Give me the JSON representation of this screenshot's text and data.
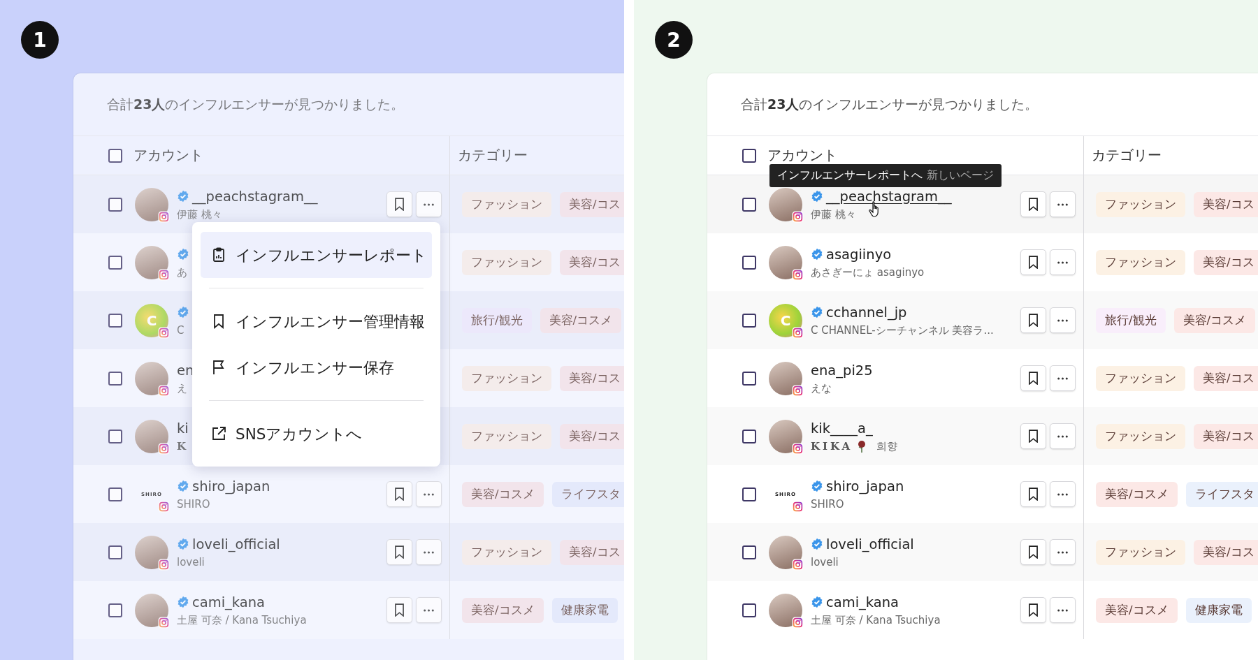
{
  "panels": [
    {
      "number": "1",
      "color": "#c9d1fb",
      "dimmed": true,
      "summary": "合計**23人**のインフルエンサーが見つかりました。",
      "header_checked": false,
      "columns": [
        "アカウント",
        "カテゴリー"
      ],
      "rows": [
        {
          "name": "__peachstagram__",
          "verified": true,
          "sub": "伊藤 桃々",
          "avatar": {
            "kind": "photo"
          },
          "checked": false,
          "hovered": false,
          "actions": true,
          "tags": [
            {
              "label": "ファッション",
              "color": "#f6ebe6"
            },
            {
              "label": "美容/コス",
              "color": "#f4e1e6"
            }
          ]
        },
        {
          "verified": true,
          "sub": "あ",
          "avatar": {
            "kind": "photo"
          },
          "checked": false,
          "hovered": false,
          "actions": false,
          "tags": [
            {
              "label": "ファッション",
              "color": "#f6ebe6"
            },
            {
              "label": "美容/コス",
              "color": "#f4e1e6"
            }
          ]
        },
        {
          "verified": true,
          "sub": "C",
          "avatar": {
            "kind": "logo",
            "text": "C"
          },
          "checked": false,
          "hovered": false,
          "actions": false,
          "tags": [
            {
              "label": "旅行/観光",
              "color": "#ece6fb"
            },
            {
              "label": "美容/コスメ",
              "color": "#f4e1e6"
            }
          ]
        },
        {
          "name": "en",
          "verified": false,
          "sub": "え",
          "avatar": {
            "kind": "photo"
          },
          "checked": false,
          "hovered": false,
          "actions": false,
          "tags": [
            {
              "label": "ファッション",
              "color": "#f6ebe6"
            },
            {
              "label": "美容/コス",
              "color": "#f4e1e6"
            }
          ]
        },
        {
          "name": "ki",
          "verified": false,
          "sub": "K",
          "kind": "serif",
          "avatar": {
            "kind": "photo"
          },
          "checked": false,
          "hovered": false,
          "actions": false,
          "tags": [
            {
              "label": "ファッション",
              "color": "#f6ebe6"
            },
            {
              "label": "美容/コス",
              "color": "#f4e1e6"
            }
          ]
        },
        {
          "name": "shiro_japan",
          "verified": true,
          "sub": "SHIRO",
          "avatar": {
            "kind": "wordmark",
            "text": "SHIRO"
          },
          "checked": false,
          "hovered": false,
          "actions": true,
          "tags": [
            {
              "label": "美容/コスメ",
              "color": "#f4e1e6"
            },
            {
              "label": "ライフスタ",
              "color": "#e2e8fb"
            }
          ]
        },
        {
          "name": "loveli_official",
          "verified": true,
          "sub": "loveli",
          "avatar": {
            "kind": "photo"
          },
          "checked": false,
          "hovered": false,
          "actions": true,
          "tags": [
            {
              "label": "ファッション",
              "color": "#f6ebe6"
            },
            {
              "label": "美容/コス",
              "color": "#f4e1e6"
            }
          ]
        },
        {
          "name": "cami_kana",
          "verified": true,
          "sub": "土屋 可奈 / Kana Tsuchiya",
          "avatar": {
            "kind": "photo"
          },
          "checked": false,
          "hovered": false,
          "actions": true,
          "tags": [
            {
              "label": "美容/コスメ",
              "color": "#f4e1e6"
            },
            {
              "label": "健康家電",
              "color": "#e2e8fb"
            }
          ]
        }
      ],
      "menu": {
        "groups": [
          [
            {
              "label": "インフルエンサーレポート",
              "kind": "report",
              "selected": true
            }
          ],
          [
            {
              "label": "インフルエンサー管理情報",
              "kind": "bookmark",
              "selected": false
            },
            {
              "label": "インフルエンサー保存",
              "kind": "flag",
              "selected": false
            }
          ],
          [
            {
              "label": "SNSアカウントへ",
              "kind": "external",
              "selected": false
            }
          ]
        ]
      }
    },
    {
      "number": "2",
      "color": "#eef8ef",
      "dimmed": false,
      "summary": "合計**23人**のインフルエンサーが見つかりました。",
      "header_checked": false,
      "columns": [
        "アカウント",
        "カテゴリー"
      ],
      "rows": [
        {
          "name": "__peachstagram__",
          "verified": true,
          "sub": "伊藤 桃々",
          "avatar": {
            "kind": "photo"
          },
          "checked": false,
          "hovered": true,
          "actions": true,
          "tags": [
            {
              "label": "ファッション",
              "color": "#fcf1e4"
            },
            {
              "label": "美容/コス",
              "color": "#fce8e6"
            }
          ]
        },
        {
          "name": "asagiinyo",
          "verified": true,
          "sub": "あさぎーにょ asaginyo",
          "avatar": {
            "kind": "photo"
          },
          "checked": false,
          "hovered": false,
          "actions": true,
          "tags": [
            {
              "label": "ファッション",
              "color": "#fcf1e4"
            },
            {
              "label": "美容/コス",
              "color": "#fce8e6"
            }
          ]
        },
        {
          "name": "cchannel_jp",
          "verified": true,
          "sub": "C CHANNEL-シーチャンネル 美容ラ...",
          "avatar": {
            "kind": "logo",
            "text": "C"
          },
          "checked": false,
          "hovered": false,
          "actions": true,
          "tags": [
            {
              "label": "旅行/観光",
              "color": "#f9eefb"
            },
            {
              "label": "美容/コスメ",
              "color": "#fce8e6"
            }
          ]
        },
        {
          "name": "ena_pi25",
          "verified": false,
          "sub": "えな",
          "avatar": {
            "kind": "photo"
          },
          "checked": false,
          "hovered": false,
          "actions": true,
          "tags": [
            {
              "label": "ファッション",
              "color": "#fcf1e4"
            },
            {
              "label": "美容/コス",
              "color": "#fce8e6"
            }
          ]
        },
        {
          "name": "kik____a_",
          "verified": false,
          "sub": "KIKA",
          "kind": "ornate",
          "sub_after": "희향",
          "avatar": {
            "kind": "photo"
          },
          "checked": false,
          "hovered": false,
          "actions": true,
          "tags": [
            {
              "label": "ファッション",
              "color": "#fcf1e4"
            },
            {
              "label": "美容/コス",
              "color": "#fce8e6"
            }
          ]
        },
        {
          "name": "shiro_japan",
          "verified": true,
          "sub": "SHIRO",
          "avatar": {
            "kind": "wordmark",
            "text": "SHIRO"
          },
          "checked": false,
          "hovered": false,
          "actions": true,
          "tags": [
            {
              "label": "美容/コスメ",
              "color": "#fce8e6"
            },
            {
              "label": "ライフスタ",
              "color": "#eaf1fc"
            }
          ]
        },
        {
          "name": "loveli_official",
          "verified": true,
          "sub": "loveli",
          "avatar": {
            "kind": "photo"
          },
          "checked": false,
          "hovered": false,
          "actions": true,
          "tags": [
            {
              "label": "ファッション",
              "color": "#fcf1e4"
            },
            {
              "label": "美容/コス",
              "color": "#fce8e6"
            }
          ]
        },
        {
          "name": "cami_kana",
          "verified": true,
          "sub": "土屋 可奈 / Kana Tsuchiya",
          "avatar": {
            "kind": "photo"
          },
          "checked": false,
          "hovered": false,
          "actions": true,
          "tags": [
            {
              "label": "美容/コスメ",
              "color": "#fce8e6"
            },
            {
              "label": "健康家電",
              "color": "#eaf1fc"
            }
          ]
        }
      ],
      "tooltip": {
        "text": "インフルエンサーレポートへ",
        "hint": "新しいページ"
      }
    }
  ]
}
